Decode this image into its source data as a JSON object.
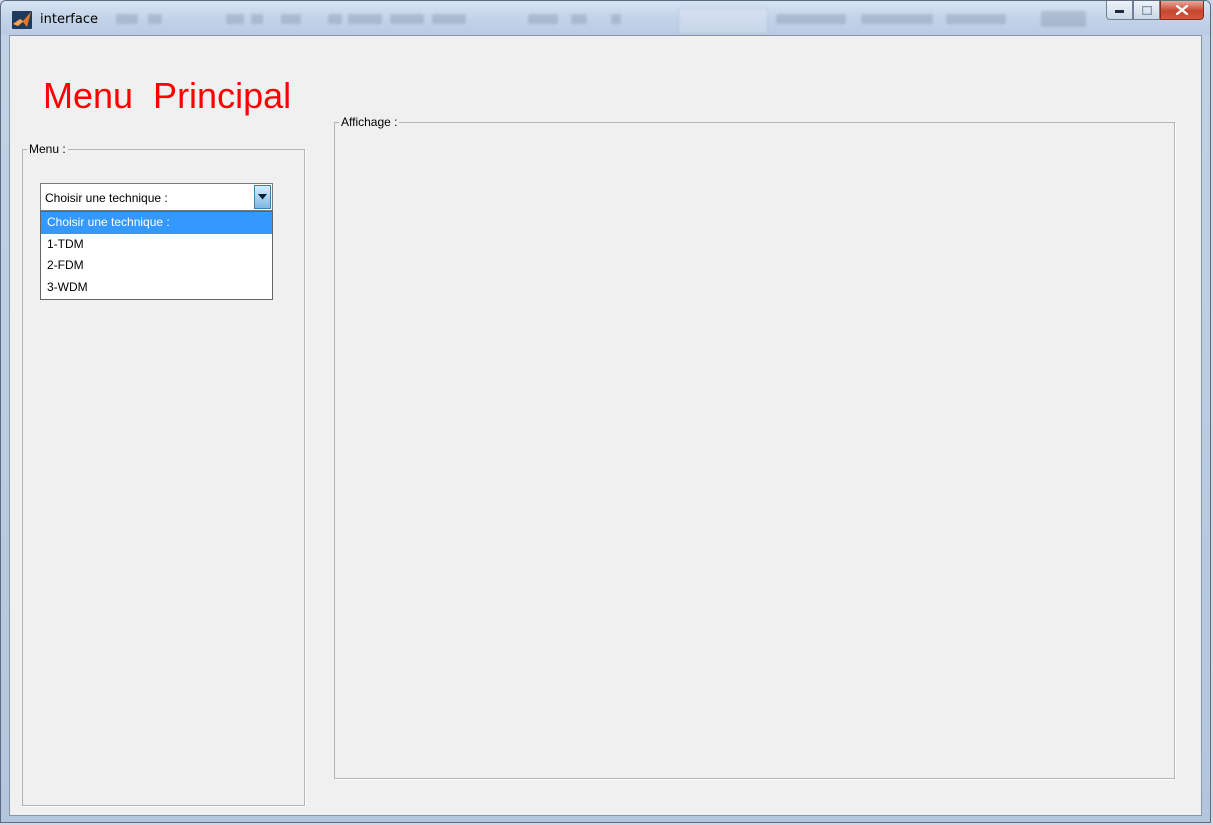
{
  "window": {
    "title": "interface"
  },
  "main_title": "Menu  Principal",
  "menu_panel": {
    "legend": "Menu :"
  },
  "technique_select": {
    "selected": "Choisir une technique :",
    "options": [
      "Choisir une technique :",
      "1-TDM",
      "2-FDM",
      "3-WDM"
    ],
    "highlighted_index": 0
  },
  "display_panel": {
    "legend": "Affichage :"
  },
  "colors": {
    "title_red": "#ff0000",
    "selection_blue": "#3399ff",
    "panel_bg": "#f0f0f0"
  }
}
